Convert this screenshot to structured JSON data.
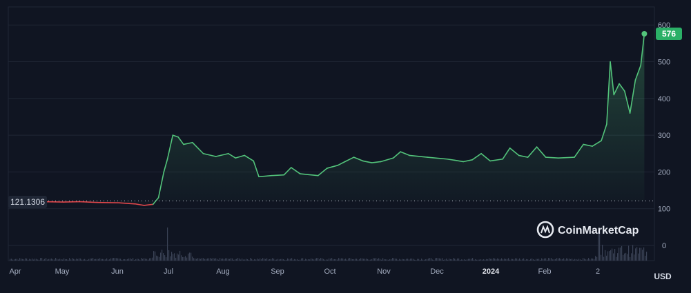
{
  "colors": {
    "background": "#101522",
    "grid": "#1f2635",
    "up_line": "#53c47b",
    "down_line": "#e2474b",
    "axis_text": "#a3acbf",
    "badge_bg": "#2bb067",
    "volume": "#3a4255"
  },
  "icons": {
    "logo": "coinmarketcap-logo-icon"
  },
  "brand": {
    "name": "CoinMarketCap"
  },
  "currency_label": "USD",
  "reference_label": "121.1306",
  "price_badge": "576",
  "chart_data": {
    "type": "area",
    "xlabel": "",
    "ylabel": "",
    "y_ticks": [
      "600",
      "500",
      "400",
      "300",
      "200",
      "100",
      "0"
    ],
    "ylim": [
      0,
      600
    ],
    "x_tick_labels": [
      "Apr",
      "May",
      "Jun",
      "Jul",
      "Aug",
      "Sep",
      "Oct",
      "Nov",
      "Dec",
      "2024",
      "Feb",
      "2"
    ],
    "reference_value": 121.1306,
    "current_value": 576,
    "grid": true,
    "series": [
      {
        "points": [
          [
            "2023-04-01",
            121.1
          ],
          [
            "2023-04-10",
            120
          ],
          [
            "2023-04-20",
            119
          ],
          [
            "2023-05-01",
            118
          ],
          [
            "2023-05-10",
            119
          ],
          [
            "2023-05-20",
            117
          ],
          [
            "2023-06-01",
            116
          ],
          [
            "2023-06-10",
            113
          ],
          [
            "2023-06-15",
            109
          ],
          [
            "2023-06-20",
            112
          ],
          [
            "2023-06-23",
            130
          ],
          [
            "2023-06-26",
            200
          ],
          [
            "2023-06-28",
            235
          ],
          [
            "2023-07-01",
            300
          ],
          [
            "2023-07-04",
            295
          ],
          [
            "2023-07-07",
            275
          ],
          [
            "2023-07-12",
            280
          ],
          [
            "2023-07-18",
            250
          ],
          [
            "2023-07-25",
            242
          ],
          [
            "2023-08-01",
            250
          ],
          [
            "2023-08-05",
            238
          ],
          [
            "2023-08-10",
            245
          ],
          [
            "2023-08-15",
            230
          ],
          [
            "2023-08-18",
            187
          ],
          [
            "2023-08-25",
            190
          ],
          [
            "2023-09-01",
            192
          ],
          [
            "2023-09-05",
            212
          ],
          [
            "2023-09-10",
            195
          ],
          [
            "2023-09-20",
            190
          ],
          [
            "2023-09-25",
            210
          ],
          [
            "2023-10-01",
            218
          ],
          [
            "2023-10-05",
            228
          ],
          [
            "2023-10-10",
            240
          ],
          [
            "2023-10-15",
            230
          ],
          [
            "2023-10-20",
            225
          ],
          [
            "2023-10-25",
            228
          ],
          [
            "2023-11-01",
            238
          ],
          [
            "2023-11-05",
            255
          ],
          [
            "2023-11-10",
            245
          ],
          [
            "2023-11-20",
            240
          ],
          [
            "2023-12-01",
            235
          ],
          [
            "2023-12-05",
            232
          ],
          [
            "2023-12-10",
            228
          ],
          [
            "2023-12-15",
            233
          ],
          [
            "2023-12-20",
            250
          ],
          [
            "2023-12-25",
            230
          ],
          [
            "2024-01-01",
            235
          ],
          [
            "2024-01-05",
            265
          ],
          [
            "2024-01-10",
            245
          ],
          [
            "2024-01-15",
            240
          ],
          [
            "2024-01-20",
            268
          ],
          [
            "2024-01-25",
            240
          ],
          [
            "2024-02-01",
            238
          ],
          [
            "2024-02-10",
            240
          ],
          [
            "2024-02-15",
            275
          ],
          [
            "2024-02-20",
            270
          ],
          [
            "2024-02-25",
            285
          ],
          [
            "2024-02-28",
            330
          ],
          [
            "2024-03-01",
            500
          ],
          [
            "2024-03-03",
            410
          ],
          [
            "2024-03-06",
            440
          ],
          [
            "2024-03-09",
            420
          ],
          [
            "2024-03-12",
            360
          ],
          [
            "2024-03-15",
            450
          ],
          [
            "2024-03-18",
            490
          ],
          [
            "2024-03-20",
            576
          ]
        ]
      }
    ]
  }
}
